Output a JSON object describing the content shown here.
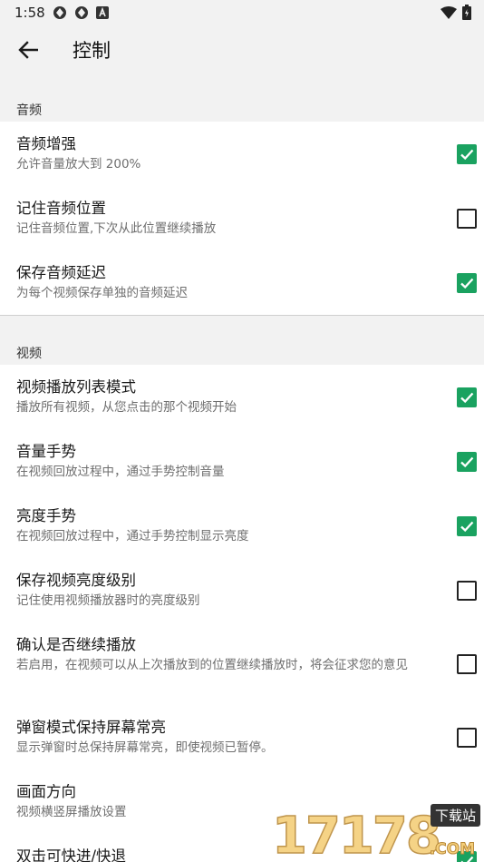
{
  "status_bar": {
    "time": "1:58"
  },
  "app_bar": {
    "title": "控制"
  },
  "sections": {
    "audio": {
      "header": "音频",
      "items": [
        {
          "title": "音频增强",
          "summary": "允许音量放大到 200%",
          "checked": true
        },
        {
          "title": "记住音频位置",
          "summary": "记住音频位置,下次从此位置继续播放",
          "checked": false
        },
        {
          "title": "保存音频延迟",
          "summary": "为每个视频保存单独的音频延迟",
          "checked": true
        }
      ]
    },
    "video": {
      "header": "视频",
      "items": [
        {
          "title": "视频播放列表模式",
          "summary": "播放所有视频，从您点击的那个视频开始",
          "checked": true
        },
        {
          "title": "音量手势",
          "summary": "在视频回放过程中，通过手势控制音量",
          "checked": true
        },
        {
          "title": "亮度手势",
          "summary": "在视频回放过程中，通过手势控制显示亮度",
          "checked": true
        },
        {
          "title": "保存视频亮度级别",
          "summary": "记住使用视频播放器时的亮度级别",
          "checked": false
        },
        {
          "title": "确认是否继续播放",
          "summary": "若启用，在视频可以从上次播放到的位置继续播放时，将会征求您的意见",
          "checked": false
        },
        {
          "title": "弹窗模式保持屏幕常亮",
          "summary": "显示弹窗时总保持屏幕常亮，即使视频已暂停。",
          "checked": false
        },
        {
          "title": "画面方向",
          "summary": "视频横竖屏播放设置"
        },
        {
          "title": "双击可快进/快退",
          "summary": ""
        }
      ]
    }
  },
  "watermark": {
    "digits": "17178",
    "badge": "下载站",
    "suffix": ".COM"
  },
  "colors": {
    "accent": "#1aa260",
    "background": "#f2f2f2",
    "surface": "#ffffff"
  }
}
